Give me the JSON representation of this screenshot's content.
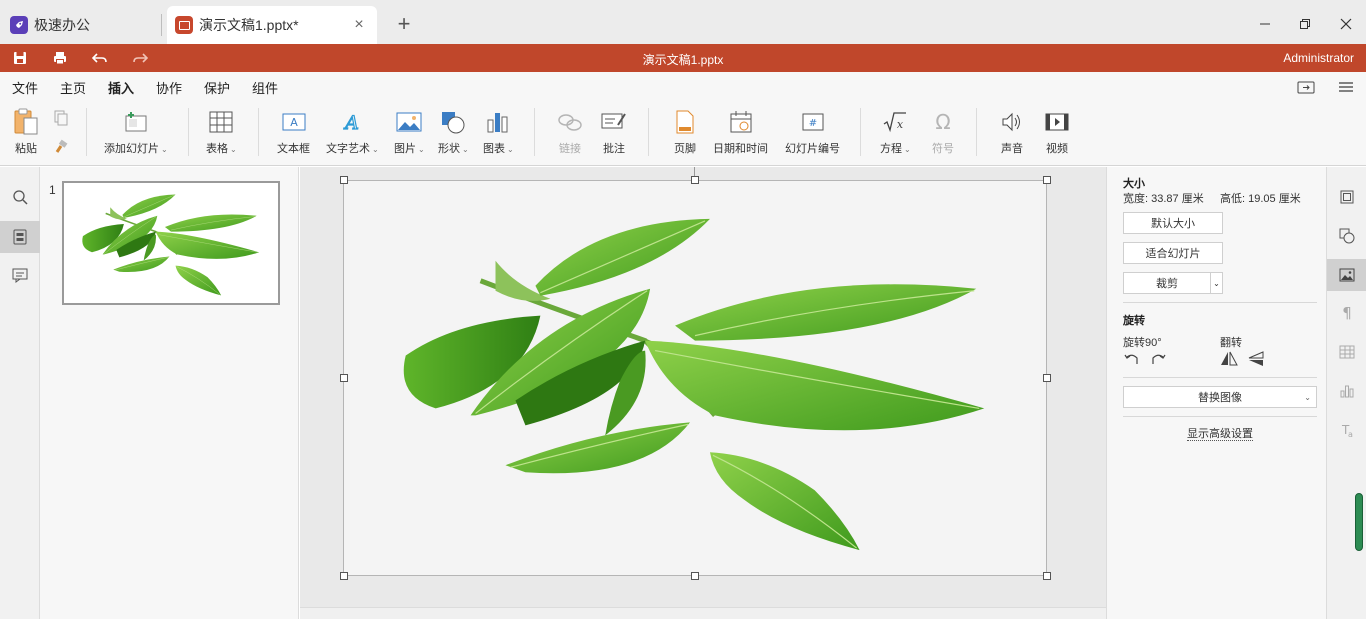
{
  "tabs": {
    "app_label": "极速办公",
    "doc_label": "演示文稿1.pptx*",
    "close_symbol": "×",
    "add_symbol": "+"
  },
  "titlebar": {
    "title": "演示文稿1.pptx",
    "user": "Administrator",
    "color": "#c0472b"
  },
  "menu": {
    "items": [
      "文件",
      "主页",
      "插入",
      "协作",
      "保护",
      "组件"
    ],
    "active": "插入"
  },
  "ribbon": {
    "paste": "粘贴",
    "add_slide": "添加幻灯片",
    "table": "表格",
    "textbox": "文本框",
    "text_art": "文字艺术",
    "image": "图片",
    "shape": "形状",
    "chart": "图表",
    "link": "链接",
    "comment": "批注",
    "footer": "页脚",
    "date_time": "日期和时间",
    "slide_number": "幻灯片编号",
    "equation": "方程",
    "symbol": "符号",
    "audio": "声音",
    "video": "视频"
  },
  "thumbnails": {
    "slide_number": "1"
  },
  "panel": {
    "size_title": "大小",
    "width_label": "宽度: 33.87 厘米",
    "height_label": "高低: 19.05 厘米",
    "default_size": "默认大小",
    "fit_slide": "适合幻灯片",
    "crop": "裁剪",
    "rotate_title": "旋转",
    "rotate90": "旋转90°",
    "flip": "翻转",
    "replace_image": "替换图像",
    "advanced": "显示高级设置"
  }
}
